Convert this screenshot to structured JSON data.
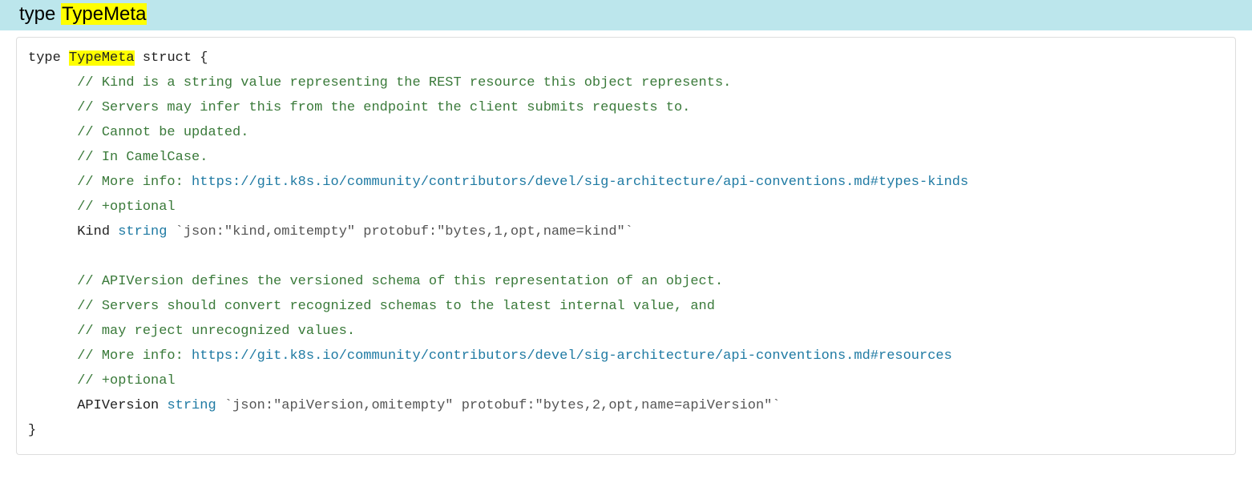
{
  "header": {
    "prefix": "type ",
    "highlight": "TypeMeta"
  },
  "code": {
    "line1_a": "type ",
    "line1_hl": "TypeMeta",
    "line1_b": " struct {",
    "indent": "      ",
    "cm_kind1": "// Kind is a string value representing the REST resource this object represents.",
    "cm_kind2": "// Servers may infer this from the endpoint the client submits requests to.",
    "cm_kind3": "// Cannot be updated.",
    "cm_kind4": "// In CamelCase.",
    "cm_kind5a": "// More info: ",
    "cm_kind5_link": "https://git.k8s.io/community/contributors/devel/sig-architecture/api-conventions.md#types-kinds",
    "cm_opt": "// +optional",
    "fld_kind_a": "Kind ",
    "fld_kind_kw": "string",
    "fld_kind_tag": " `json:\"kind,omitempty\" protobuf:\"bytes,1,opt,name=kind\"`",
    "blank": "",
    "cm_apiv1": "// APIVersion defines the versioned schema of this representation of an object.",
    "cm_apiv2": "// Servers should convert recognized schemas to the latest internal value, and",
    "cm_apiv3": "// may reject unrecognized values.",
    "cm_apiv4a": "// More info: ",
    "cm_apiv4_link": "https://git.k8s.io/community/contributors/devel/sig-architecture/api-conventions.md#resources",
    "fld_apiv_a": "APIVersion ",
    "fld_apiv_kw": "string",
    "fld_apiv_tag": " `json:\"apiVersion,omitempty\" protobuf:\"bytes,2,opt,name=apiVersion\"`",
    "close": "}"
  }
}
